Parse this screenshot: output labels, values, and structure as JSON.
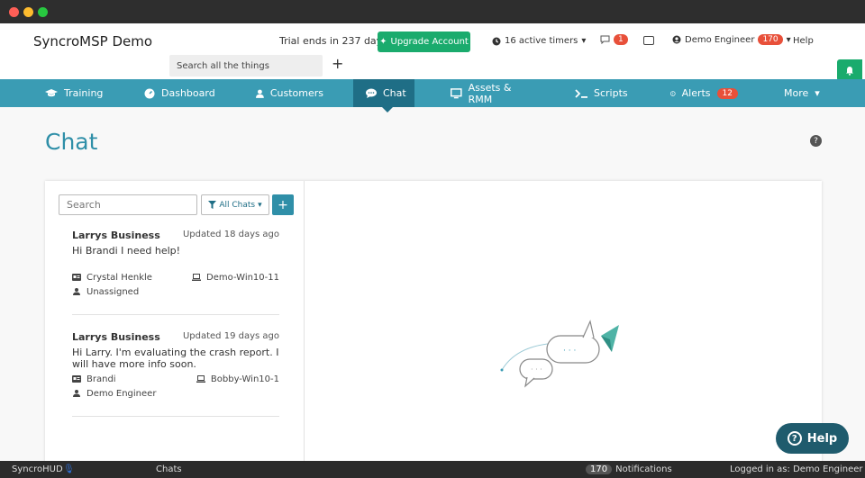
{
  "window": {
    "title": ""
  },
  "header": {
    "brand": "SyncroMSP Demo",
    "trial_text": "Trial ends in 237 days",
    "upgrade_label": "Upgrade Account",
    "timers_label": "16 active timers",
    "messages_count": "1",
    "user_name": "Demo Engineer",
    "user_badge": "170",
    "help_label": "Help",
    "search_placeholder": "Search all the things"
  },
  "nav": {
    "items": [
      {
        "label": "Training",
        "icon": "graduation-cap-icon"
      },
      {
        "label": "Dashboard",
        "icon": "dashboard-icon"
      },
      {
        "label": "Customers",
        "icon": "user-icon"
      },
      {
        "label": "Chat",
        "icon": "chat-icon",
        "active": true
      },
      {
        "label": "Assets & RMM",
        "icon": "monitor-icon"
      },
      {
        "label": "Scripts",
        "icon": "terminal-icon"
      },
      {
        "label": "Alerts",
        "icon": "alert-icon",
        "badge": "12"
      },
      {
        "label": "More",
        "icon": "caret-down-icon"
      }
    ]
  },
  "page": {
    "title": "Chat",
    "search_placeholder": "Search",
    "filter_label": "All Chats"
  },
  "conversations": [
    {
      "business": "Larrys Business",
      "updated": "Updated 18 days ago",
      "message": "Hi Brandi I need help!",
      "contact": "Crystal Henkle",
      "device": "Demo-Win10-11",
      "assignee": "Unassigned"
    },
    {
      "business": "Larrys Business",
      "updated": "Updated 19 days ago",
      "message": "Hi Larry. I'm evaluating the crash report. I will have more info soon.",
      "contact": "Brandi",
      "device": "Bobby-Win10-1",
      "assignee": "Demo Engineer"
    }
  ],
  "help_fab": {
    "label": "Help"
  },
  "statusbar": {
    "app": "SyncroHUD",
    "section": "Chats",
    "notifications_count": "170",
    "notifications_label": "Notifications",
    "logged_in": "Logged in as: Demo Engineer"
  },
  "colors": {
    "accent": "#3a9cb4",
    "accent_dark": "#1f6e86",
    "success": "#1aab6d",
    "danger": "#e8503a"
  }
}
